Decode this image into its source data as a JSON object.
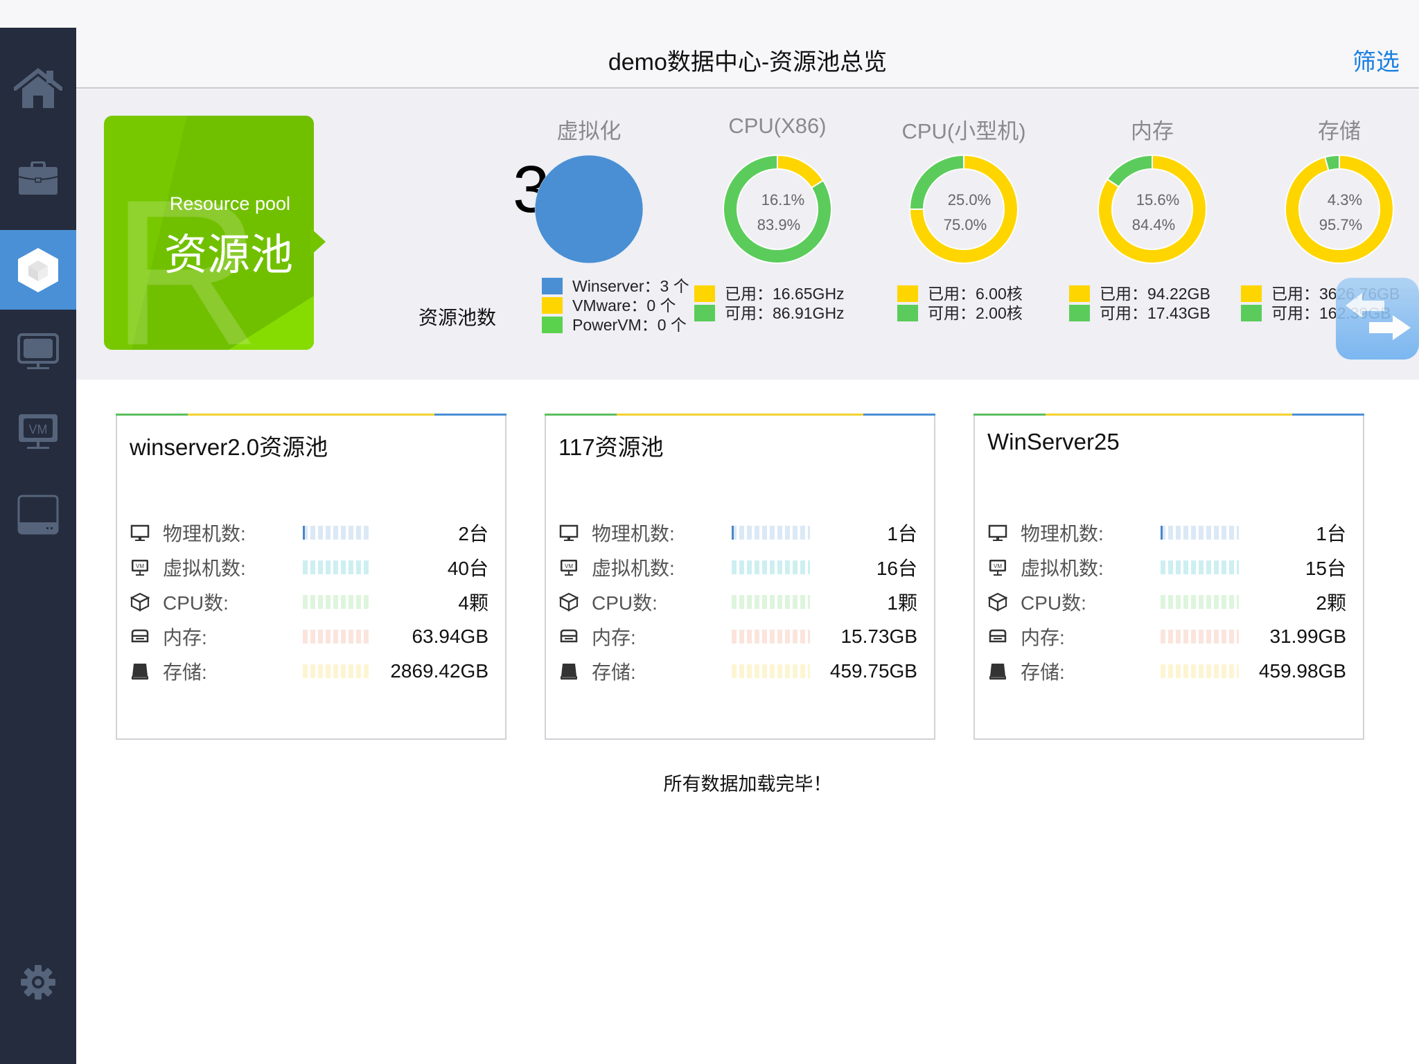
{
  "header": {
    "title": "demo数据中心-资源池总览",
    "filter_label": "筛选"
  },
  "sidebar": {
    "items": [
      {
        "icon": "home-icon",
        "active": false
      },
      {
        "icon": "briefcase-icon",
        "active": false
      },
      {
        "icon": "resource-pool-cube-icon",
        "active": true
      },
      {
        "icon": "physical-machine-monitor-icon",
        "active": false
      },
      {
        "icon": "vm-monitor-icon",
        "active": false
      },
      {
        "icon": "storage-device-icon",
        "active": false
      },
      {
        "icon": "gear-icon",
        "active": false
      }
    ]
  },
  "summary": {
    "badge_en": "Resource pool",
    "badge_cn": "资源池",
    "pool_count": "3",
    "pool_count_label": "资源池数"
  },
  "chart_data": [
    {
      "type": "pie",
      "title": "虚拟化",
      "labels": [
        "Winserver",
        "VMware",
        "PowerVM"
      ],
      "values": [
        3,
        0,
        0
      ],
      "colors": [
        "#4a8fd4",
        "#ffd500",
        "#5bd24e"
      ],
      "legend": [
        "Winserver：3 个",
        "VMware：0 个",
        "PowerVM：0 个"
      ]
    },
    {
      "type": "donut",
      "title": "CPU(X86)",
      "labels": [
        "已用",
        "可用"
      ],
      "values": [
        16.65,
        86.91
      ],
      "unit": "GHz",
      "percent_labels": [
        "16.1%",
        "83.9%"
      ],
      "colors": [
        "#ffd500",
        "#5bcc5b"
      ],
      "legend": [
        "已用：16.65GHz",
        "可用：86.91GHz"
      ]
    },
    {
      "type": "donut",
      "title": "CPU(小型机)",
      "labels": [
        "已用",
        "可用"
      ],
      "values": [
        6.0,
        2.0
      ],
      "unit": "核",
      "percent_labels": [
        "75.0%",
        "25.0%"
      ],
      "colors": [
        "#ffd500",
        "#5bcc5b"
      ],
      "legend": [
        "已用：6.00核",
        "可用：2.00核"
      ]
    },
    {
      "type": "donut",
      "title": "内存",
      "labels": [
        "已用",
        "可用"
      ],
      "values": [
        94.22,
        17.43
      ],
      "unit": "GB",
      "percent_labels": [
        "84.4%",
        "15.6%"
      ],
      "colors": [
        "#ffd500",
        "#5bcc5b"
      ],
      "legend": [
        "已用：94.22GB",
        "可用：17.43GB"
      ]
    },
    {
      "type": "donut",
      "title": "存储",
      "labels": [
        "已用",
        "可用"
      ],
      "values": [
        3626.76,
        162.39
      ],
      "unit": "GB",
      "percent_labels": [
        "95.7%",
        "4.3%"
      ],
      "colors": [
        "#ffd500",
        "#5bcc5b"
      ],
      "legend": [
        "已用：3626.76GB",
        "可用：162.39GB"
      ]
    }
  ],
  "pools": [
    {
      "name": "winserver2.0资源池",
      "rows": [
        {
          "icon": "physical-machine-icon",
          "label": "物理机数:",
          "value": "2台",
          "fill": 0.03,
          "color": "#dbe8f6",
          "fill_color": "#4a86c8"
        },
        {
          "icon": "vm-icon",
          "label": "虚拟机数:",
          "value": "40台",
          "fill": 0,
          "color": "#cdeff1",
          "fill_color": "#4bb8c6"
        },
        {
          "icon": "cpu-cube-icon",
          "label": "CPU数:",
          "value": "4颗",
          "fill": 0,
          "color": "#ddf5dc",
          "fill_color": "#5bcc5b"
        },
        {
          "icon": "memory-icon",
          "label": "内存:",
          "value": "63.94GB",
          "fill": 0,
          "color": "#fbe4dc",
          "fill_color": "#f08a6a"
        },
        {
          "icon": "storage-disk-icon",
          "label": "存储:",
          "value": "2869.42GB",
          "fill": 0,
          "color": "#fdf5d2",
          "fill_color": "#ffd500"
        }
      ]
    },
    {
      "name": "117资源池",
      "rows": [
        {
          "icon": "physical-machine-icon",
          "label": "物理机数:",
          "value": "1台",
          "fill": 0.02,
          "color": "#dbe8f6",
          "fill_color": "#4a86c8"
        },
        {
          "icon": "vm-icon",
          "label": "虚拟机数:",
          "value": "16台",
          "fill": 0,
          "color": "#cdeff1",
          "fill_color": "#4bb8c6"
        },
        {
          "icon": "cpu-cube-icon",
          "label": "CPU数:",
          "value": "1颗",
          "fill": 0,
          "color": "#ddf5dc",
          "fill_color": "#5bcc5b"
        },
        {
          "icon": "memory-icon",
          "label": "内存:",
          "value": "15.73GB",
          "fill": 0,
          "color": "#fbe4dc",
          "fill_color": "#f08a6a"
        },
        {
          "icon": "storage-disk-icon",
          "label": "存储:",
          "value": "459.75GB",
          "fill": 0,
          "color": "#fdf5d2",
          "fill_color": "#ffd500"
        }
      ]
    },
    {
      "name": "WinServer25",
      "rows": [
        {
          "icon": "physical-machine-icon",
          "label": "物理机数:",
          "value": "1台",
          "fill": 0.02,
          "color": "#dbe8f6",
          "fill_color": "#4a86c8"
        },
        {
          "icon": "vm-icon",
          "label": "虚拟机数:",
          "value": "15台",
          "fill": 0,
          "color": "#cdeff1",
          "fill_color": "#4bb8c6"
        },
        {
          "icon": "cpu-cube-icon",
          "label": "CPU数:",
          "value": "2颗",
          "fill": 0,
          "color": "#ddf5dc",
          "fill_color": "#5bcc5b"
        },
        {
          "icon": "memory-icon",
          "label": "内存:",
          "value": "31.99GB",
          "fill": 0,
          "color": "#fbe4dc",
          "fill_color": "#f08a6a"
        },
        {
          "icon": "storage-disk-icon",
          "label": "存储:",
          "value": "459.98GB",
          "fill": 0,
          "color": "#fdf5d2",
          "fill_color": "#ffd500"
        }
      ]
    }
  ],
  "card_top_colors": [
    "#5bbf5f",
    "#f2d230",
    "#4a8fd4"
  ],
  "footer": {
    "message": "所有数据加载完毕！"
  },
  "colors": {
    "sidebar_bg": "#252c3e",
    "sidebar_active": "#4a90d6",
    "accent": "#1a7fe0"
  }
}
